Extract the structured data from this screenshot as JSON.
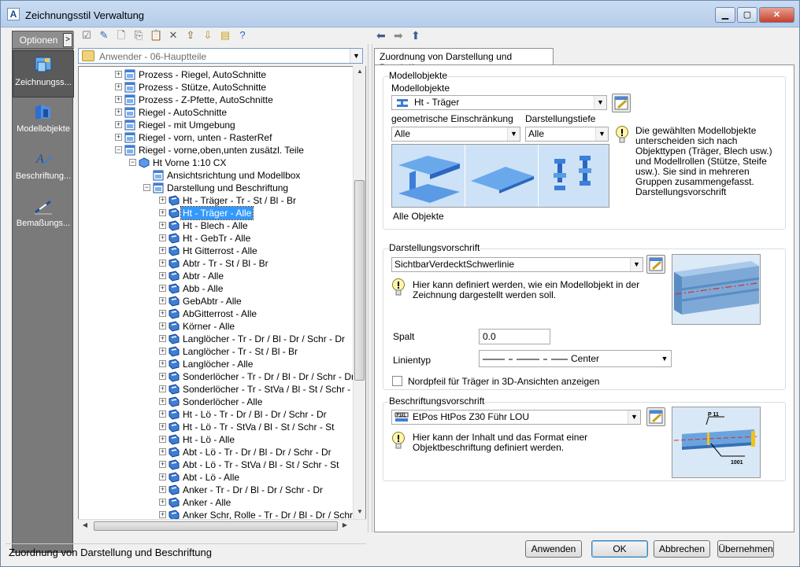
{
  "window": {
    "title": "Zeichnungsstil Verwaltung",
    "app_icon": "A",
    "min": "▁",
    "max": "▢",
    "close": "✕"
  },
  "nav": {
    "options_label": "Optionen",
    "items": [
      {
        "label": "Zeichnungss...",
        "icon": "drawing-style-icon"
      },
      {
        "label": "Modellobjekte",
        "icon": "model-objects-icon"
      },
      {
        "label": "Beschriftung...",
        "icon": "labeling-icon"
      },
      {
        "label": "Bemaßungs...",
        "icon": "dimension-icon"
      }
    ]
  },
  "path": {
    "text": "Anwender - 06-Hauptteile"
  },
  "tree": {
    "rows": [
      {
        "label": "Prozess - Riegel, AutoSchnitte",
        "level": 0
      },
      {
        "label": "Prozess - Stütze, AutoSchnitte",
        "level": 0
      },
      {
        "label": "Prozess - Z-Pfette, AutoSchnitte",
        "level": 0
      },
      {
        "label": "Riegel - AutoSchnitte",
        "level": 0
      },
      {
        "label": "Riegel - mit Umgebung",
        "level": 0
      },
      {
        "label": "Riegel - vorn, unten - RasterRef",
        "level": 0
      },
      {
        "label": "Riegel - vorne,oben,unten zusätzl. Teile",
        "level": 0
      },
      {
        "label": "Ht Vorne 1:10 CX",
        "level": 1
      },
      {
        "label": "Ansichtsrichtung und Modellbox",
        "level": 2
      },
      {
        "label": "Darstellung und Beschriftung",
        "level": 2
      },
      {
        "label": "Ht - Träger - Tr - St / Bl - Br",
        "level": 3
      },
      {
        "label": "Ht - Träger - Alle",
        "level": 3,
        "selected": true
      },
      {
        "label": "Ht - Blech - Alle",
        "level": 3
      },
      {
        "label": "Ht - GebTr - Alle",
        "level": 3
      },
      {
        "label": "Ht Gitterrost - Alle",
        "level": 3
      },
      {
        "label": "Abtr - Tr - St / Bl - Br",
        "level": 3
      },
      {
        "label": "Abtr - Alle",
        "level": 3
      },
      {
        "label": "Abb - Alle",
        "level": 3
      },
      {
        "label": "GebAbtr - Alle",
        "level": 3
      },
      {
        "label": "AbGitterrost - Alle",
        "level": 3
      },
      {
        "label": "Körner - Alle",
        "level": 3
      },
      {
        "label": "Langlöcher - Tr - Dr / Bl - Dr / Schr - Dr",
        "level": 3
      },
      {
        "label": "Langlöcher - Tr - St / Bl - Br",
        "level": 3
      },
      {
        "label": "Langlöcher - Alle",
        "level": 3
      },
      {
        "label": "Sonderlöcher - Tr - Dr / Bl - Dr / Schr - Dr",
        "level": 3
      },
      {
        "label": "Sonderlöcher - Tr - StVa / Bl - St / Schr - St",
        "level": 3
      },
      {
        "label": "Sonderlöcher - Alle",
        "level": 3
      },
      {
        "label": "Ht - Lö - Tr - Dr / Bl - Dr / Schr - Dr",
        "level": 3
      },
      {
        "label": "Ht - Lö - Tr - StVa / Bl - St / Schr - St",
        "level": 3
      },
      {
        "label": "Ht - Lö - Alle",
        "level": 3
      },
      {
        "label": "Abt - Lö - Tr - Dr / Bl - Dr / Schr - Dr",
        "level": 3
      },
      {
        "label": "Abt - Lö - Tr - StVa / Bl - St / Schr - St",
        "level": 3
      },
      {
        "label": "Abt - Lö - Alle",
        "level": 3
      },
      {
        "label": "Anker - Tr - Dr / Bl - Dr / Schr - Dr",
        "level": 3
      },
      {
        "label": "Anker - Alle",
        "level": 3
      },
      {
        "label": "Anker Schr, Rolle - Tr - Dr / Bl - Dr / Schr - Dr",
        "level": 3
      }
    ]
  },
  "tab": {
    "label": "Zuordnung von Darstellung und Beschriftung"
  },
  "modell": {
    "group_label": "Modellobjekte",
    "field_label": "Modellobjekte",
    "selected": "Ht - Träger",
    "geo_label": "geometrische Einschränkung",
    "geo_value": "Alle",
    "tiefe_label": "Darstellungstiefe",
    "tiefe_value": "Alle",
    "info": "Die gewählten Modellobjekte unterscheiden sich nach Objekttypen (Träger, Blech usw.) und Modellrollen (Stütze, Steife usw.). Sie sind in mehreren Gruppen zusammengefasst. Darstellungsvorschrift",
    "caption": "Alle Objekte"
  },
  "darst": {
    "group_label": "Darstellungsvorschrift",
    "selected": "SichtbarVerdecktSchwerlinie",
    "info": "Hier kann definiert werden, wie ein Modellobjekt in der Zeichnung dargestellt werden soll.",
    "spalt_label": "Spalt",
    "spalt_value": "0.0",
    "linientyp_label": "Linientyp",
    "linientyp_value": "Center",
    "nordpfeil_label": "Nordpfeil für Träger in 3D-Ansichten anzeigen"
  },
  "beschr": {
    "group_label": "Beschriftungsvorschrift",
    "selected": "EtPos HtPos Z30 Führ LOU",
    "info": "Hier kann der Inhalt und das Format einer Objektbeschriftung definiert werden.",
    "preview_p": "P 11",
    "preview_n": "1001"
  },
  "status": {
    "text": "Zuordnung von Darstellung und Beschriftung"
  },
  "buttons": {
    "apply": "Anwenden",
    "ok": "OK",
    "cancel": "Abbrechen",
    "take": "Übernehmen"
  },
  "colors": {
    "accent": "#3399ff",
    "nav_bg": "#7a7a7a"
  }
}
